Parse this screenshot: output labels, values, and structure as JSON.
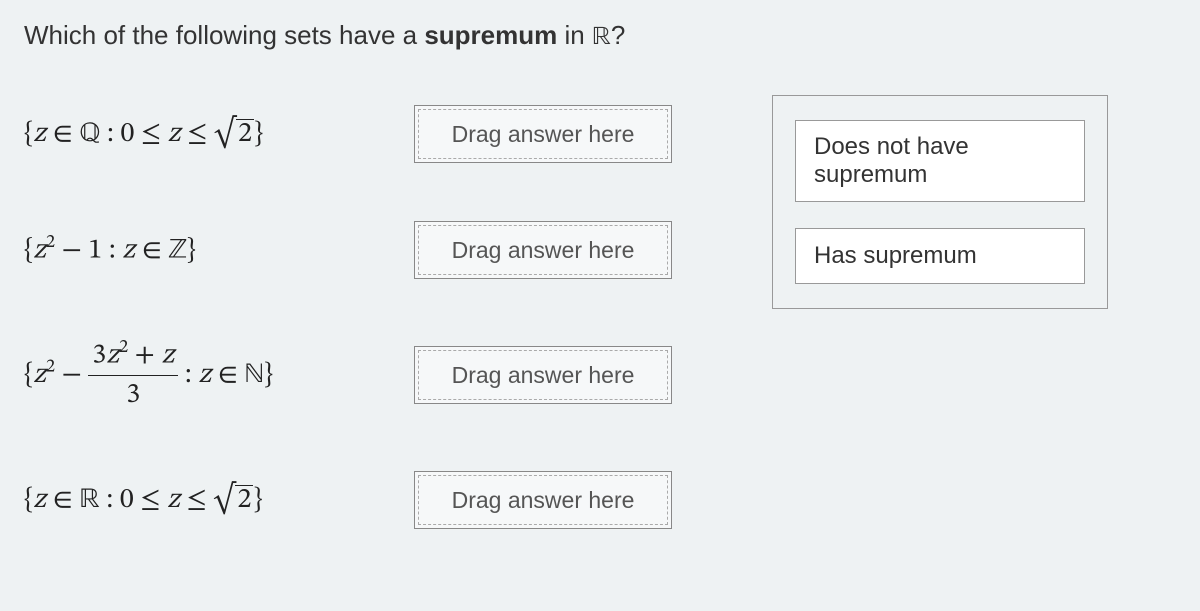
{
  "question": {
    "prefix": "Which of the following sets have a ",
    "bold": "supremum",
    "suffix": " in ",
    "set": "ℝ",
    "end": "?"
  },
  "items": [
    {
      "placeholder": "Drag answer here"
    },
    {
      "placeholder": "Drag answer here"
    },
    {
      "placeholder": "Drag answer here"
    },
    {
      "placeholder": "Drag answer here"
    }
  ],
  "answers": [
    {
      "label": "Does not have supremum"
    },
    {
      "label": "Has supremum"
    }
  ],
  "math": {
    "z": "z",
    "Q": "ℚ",
    "Z": "ℤ",
    "N": "ℕ",
    "R": "ℝ",
    "lbrace": "{",
    "rbrace": "}",
    "in": "∈",
    "leq": "≤",
    "minus": "−",
    "colon": ":",
    "zero": "0",
    "one": "1",
    "two": "2",
    "three": "3",
    "plus": "+"
  }
}
